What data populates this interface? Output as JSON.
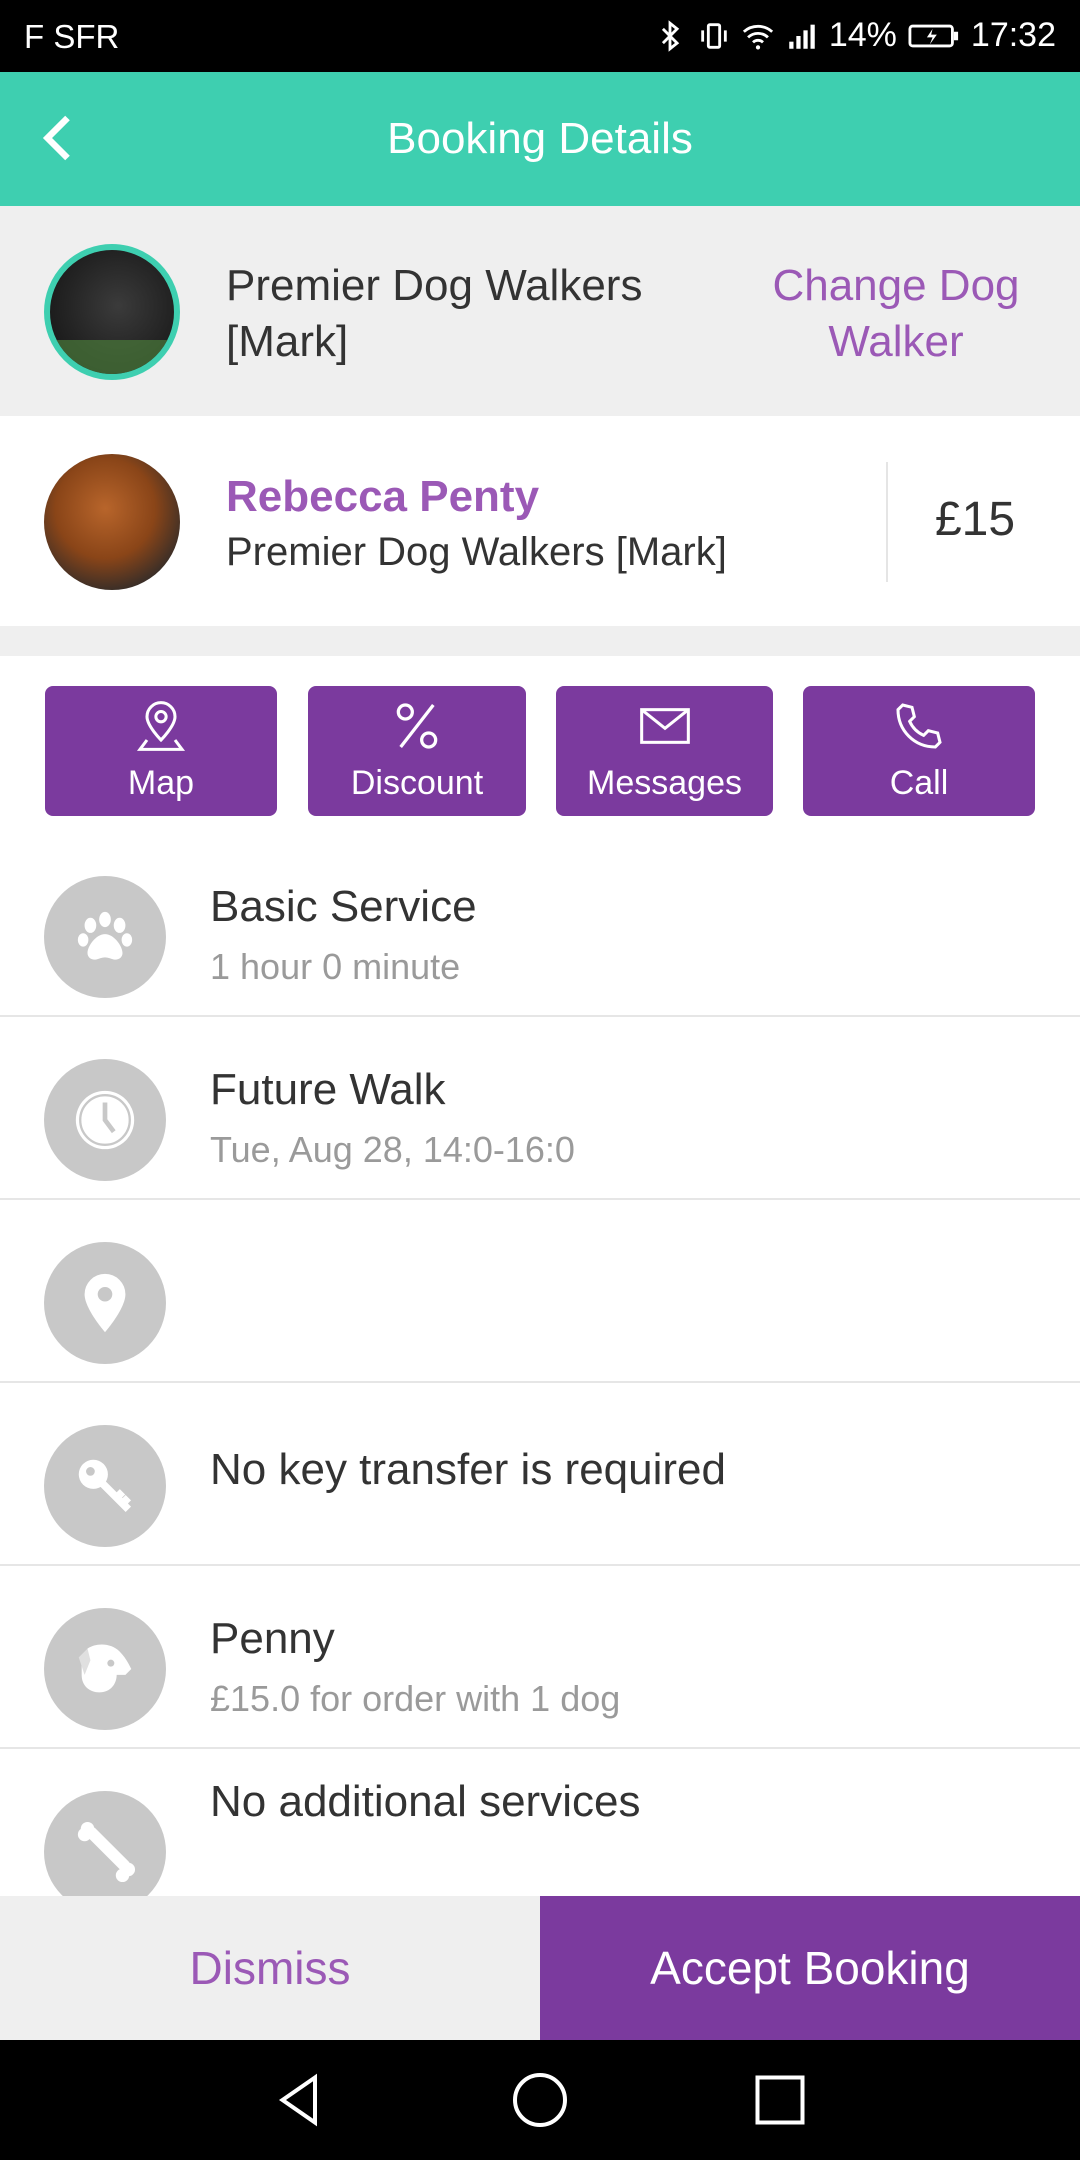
{
  "status_bar": {
    "carrier": "F SFR",
    "battery": "14%",
    "time": "17:32"
  },
  "app_bar": {
    "title": "Booking Details"
  },
  "walker": {
    "name": "Premier Dog Walkers [Mark]",
    "change_label": "Change Dog Walker"
  },
  "client": {
    "name": "Rebecca Penty",
    "company": "Premier Dog Walkers [Mark]",
    "price": "£15"
  },
  "actions": [
    {
      "label": "Map",
      "icon": "map-pin-icon"
    },
    {
      "label": "Discount",
      "icon": "percent-icon"
    },
    {
      "label": "Messages",
      "icon": "envelope-icon"
    },
    {
      "label": "Call",
      "icon": "phone-icon"
    }
  ],
  "details": [
    {
      "icon": "paw-icon",
      "title": "Basic Service",
      "subtitle": "1 hour  0 minute"
    },
    {
      "icon": "clock-icon",
      "title": "Future Walk",
      "subtitle": "Tue, Aug 28, 14:0-16:0"
    },
    {
      "icon": "location-icon",
      "title": "",
      "subtitle": ""
    },
    {
      "icon": "key-icon",
      "title": "No key transfer is required",
      "subtitle": ""
    },
    {
      "icon": "dog-icon",
      "title": "Penny",
      "subtitle": "£15.0 for order with 1 dog"
    },
    {
      "icon": "bone-icon",
      "title": "No additional services",
      "subtitle": ""
    }
  ],
  "footer": {
    "dismiss_label": "Dismiss",
    "accept_label": "Accept Booking"
  },
  "colors": {
    "teal": "#3ecfb0",
    "purple": "#7b3a9e",
    "purple_text": "#9b59b6"
  }
}
